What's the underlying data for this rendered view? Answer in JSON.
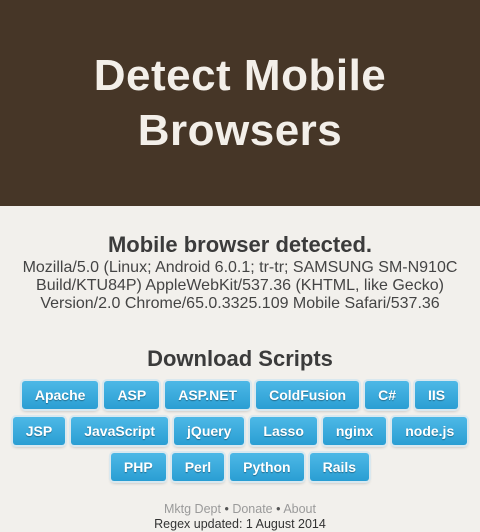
{
  "header": {
    "title": "Detect Mobile Browsers"
  },
  "detection": {
    "title": "Mobile browser detected.",
    "user_agent": "Mozilla/5.0 (Linux; Android 6.0.1; tr-tr; SAMSUNG SM-N910C Build/KTU84P) AppleWebKit/537.36 (KHTML, like Gecko) Version/2.0 Chrome/65.0.3325.109 Mobile Safari/537.36"
  },
  "downloads": {
    "title": "Download Scripts",
    "row1": [
      "Apache",
      "ASP",
      "ASP.NET",
      "ColdFusion",
      "C#",
      "IIS"
    ],
    "row2": [
      "JSP",
      "JavaScript",
      "jQuery",
      "Lasso",
      "nginx",
      "node.js"
    ],
    "row3": [
      "PHP",
      "Perl",
      "Python",
      "Rails"
    ]
  },
  "footer": {
    "links": [
      "Mktg Dept",
      "Donate",
      "About"
    ],
    "separator": "•",
    "regex_updated": "Regex updated: 1 August 2014"
  },
  "colors": {
    "header_bg": "#463627",
    "button": "#2a9ed3",
    "page_bg": "#f2f0ec"
  }
}
